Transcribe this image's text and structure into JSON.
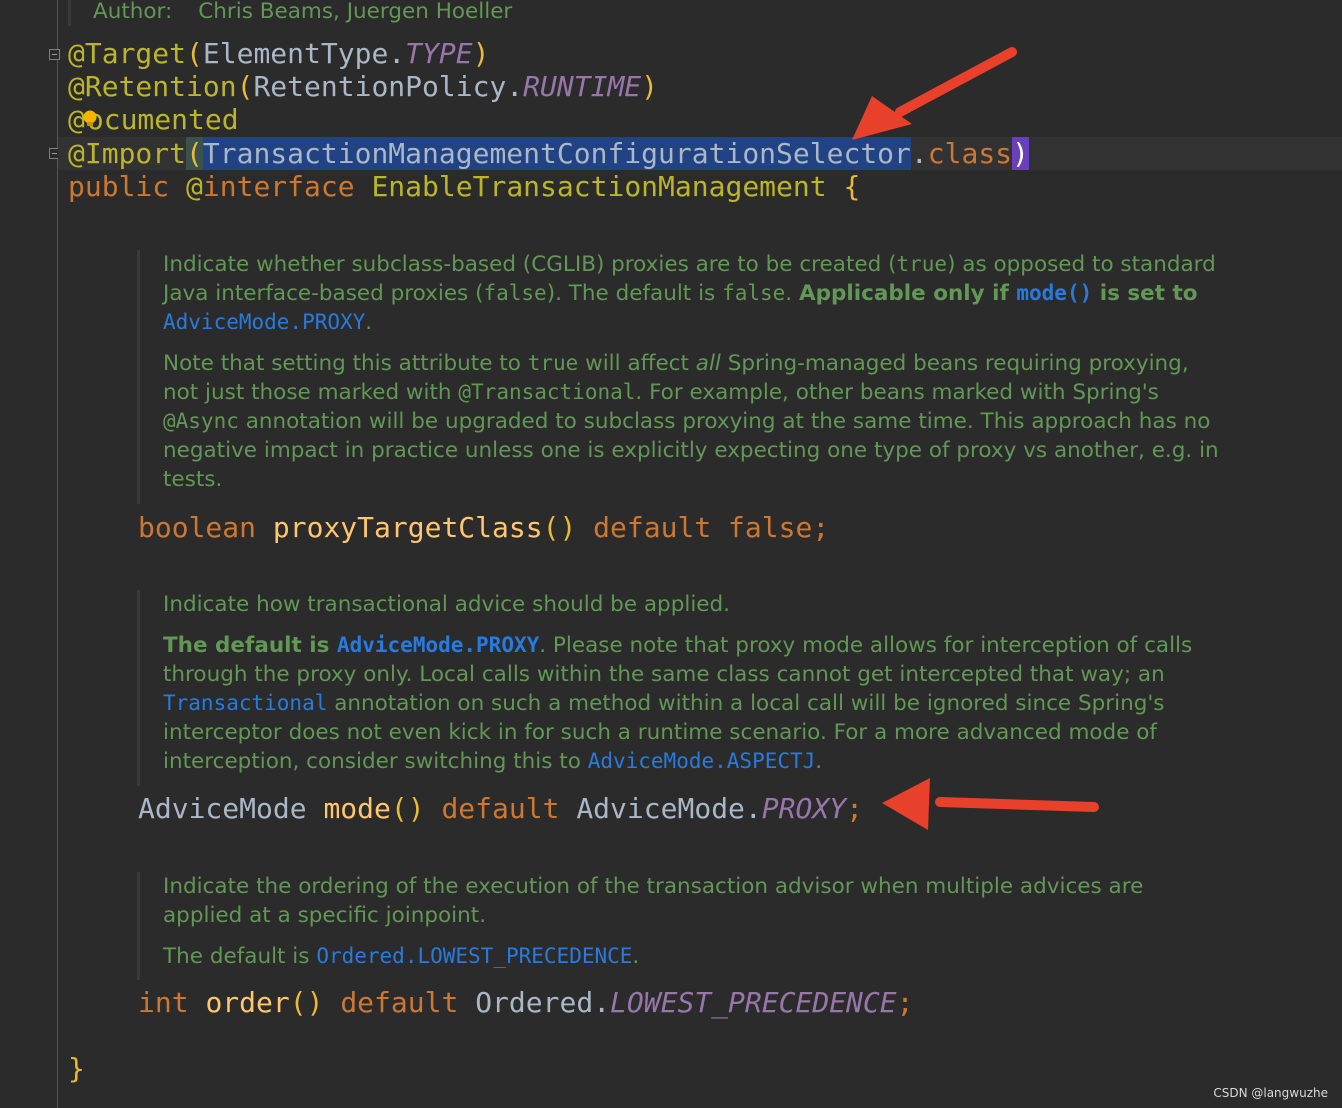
{
  "header": {
    "author_label": "Author:",
    "author_value": "Chris Beams, Juergen Hoeller"
  },
  "code": {
    "line1": {
      "at": "@Target",
      "open": "(",
      "cls": "ElementType.",
      "enum": "TYPE",
      "close": ")"
    },
    "line2": {
      "at": "@Retention",
      "open": "(",
      "cls": "RetentionPolicy.",
      "enum": "RUNTIME",
      "close": ")"
    },
    "line3": {
      "at": "@",
      "rest": "ocumented"
    },
    "line4": {
      "at": "@Import",
      "open": "(",
      "cls": "TransactionManagementConfigurationSelector",
      "dot": ".",
      "kw": "class",
      "close": ")"
    },
    "line5": {
      "kw1": "public",
      "at": "@",
      "kw2": "interface",
      "name": "EnableTransactionManagement",
      "brace": "{"
    },
    "m1": {
      "type": "boolean",
      "name": "proxyTargetClass",
      "parens": "()",
      "kw": "default",
      "value": "false",
      "semi": ";"
    },
    "m2": {
      "type": "AdviceMode",
      "name": "mode",
      "parens": "()",
      "kw": "default",
      "cls": "AdviceMode.",
      "enum": "PROXY",
      "semi": ";"
    },
    "m3": {
      "type": "int",
      "name": "order",
      "parens": "()",
      "kw": "default",
      "cls": "Ordered.",
      "enum": "LOWEST_PRECEDENCE",
      "semi": ";"
    },
    "end_brace": "}"
  },
  "doc1": {
    "p1": {
      "a": "Indicate whether subclass-based (CGLIB) proxies are to be created (",
      "true": "true",
      "b": ") as opposed to standard Java interface-based proxies (",
      "false1": "false",
      "c": "). The default is ",
      "false2": "false",
      "d": ". ",
      "bold1": "Applicable only if ",
      "link1": "mode()",
      "bold2": " is set to",
      "link2": "AdviceMode.PROXY",
      "e": "."
    },
    "p2": {
      "a": "Note that setting this attribute to ",
      "true": "true",
      "b": " will affect ",
      "all": "all",
      "c": " Spring-managed beans requiring proxying, not just those marked with ",
      "tx": "@Transactional",
      "d": ". For example, other beans marked with Spring's ",
      "async": "@Async",
      "e": " annotation will be upgraded to subclass proxying at the same time. This approach has no negative impact in practice unless one is explicitly expecting one type of proxy vs another, e.g. in tests."
    }
  },
  "doc2": {
    "p1": "Indicate how transactional advice should be applied.",
    "p2": {
      "bold": "The default is ",
      "link1": "AdviceMode.PROXY",
      "a": ". Please note that proxy mode allows for interception of calls through the proxy only. Local calls within the same class cannot get intercepted that way; an ",
      "link2": "Transactional",
      "b": " annotation on such a method within a local call will be ignored since Spring's interceptor does not even kick in for such a runtime scenario. For a more advanced mode of interception, consider switching this to ",
      "link3": "AdviceMode.ASPECTJ",
      "c": "."
    }
  },
  "doc3": {
    "p1": "Indicate the ordering of the execution of the transaction advisor when multiple advices are applied at a specific joinpoint.",
    "p2": {
      "a": "The default is ",
      "link": "Ordered.LOWEST_PRECEDENCE",
      "b": "."
    }
  },
  "watermark": "CSDN @langwuzhe",
  "colors": {
    "annotation": "#bbb529",
    "keyword": "#cc7832",
    "method": "#ffc66d",
    "enum": "#9876aa",
    "doc": "#629755",
    "link": "#287bde",
    "arrow": "#e8402a"
  }
}
